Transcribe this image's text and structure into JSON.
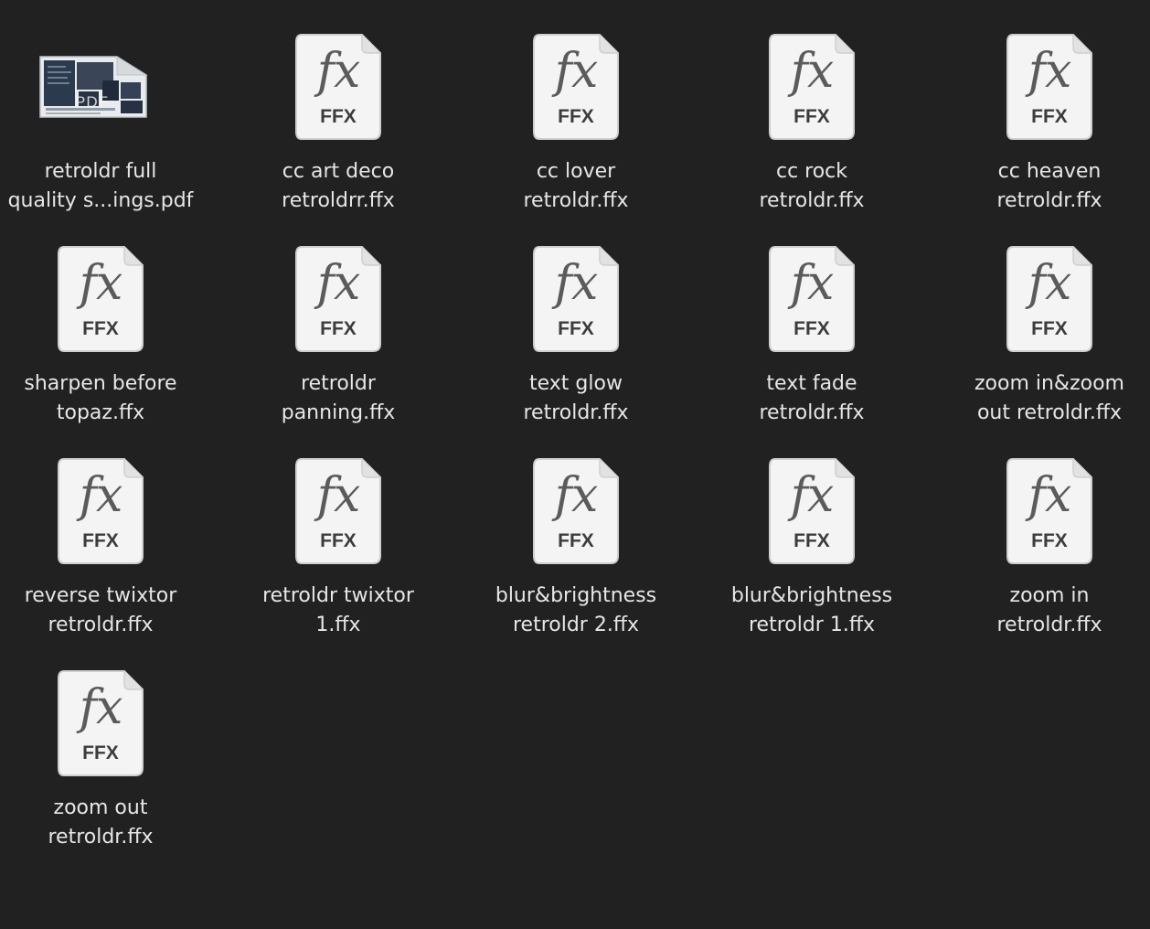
{
  "files": [
    {
      "name_line1": "retroldr full",
      "name_line2": "quality s...ings.pdf",
      "kind": "pdf",
      "thumb_label": "PDF"
    },
    {
      "name_line1": "cc art deco",
      "name_line2": "retroldrr.ffx",
      "kind": "ffx",
      "glyph": "fx",
      "ext": "FFX"
    },
    {
      "name_line1": "cc lover",
      "name_line2": "retroldr.ffx",
      "kind": "ffx",
      "glyph": "fx",
      "ext": "FFX"
    },
    {
      "name_line1": "cc rock",
      "name_line2": "retroldr.ffx",
      "kind": "ffx",
      "glyph": "fx",
      "ext": "FFX"
    },
    {
      "name_line1": "cc heaven",
      "name_line2": "retroldr.ffx",
      "kind": "ffx",
      "glyph": "fx",
      "ext": "FFX"
    },
    {
      "name_line1": "sharpen before",
      "name_line2": "topaz.ffx",
      "kind": "ffx",
      "glyph": "fx",
      "ext": "FFX"
    },
    {
      "name_line1": "retroldr",
      "name_line2": "panning.ffx",
      "kind": "ffx",
      "glyph": "fx",
      "ext": "FFX"
    },
    {
      "name_line1": "text glow",
      "name_line2": "retroldr.ffx",
      "kind": "ffx",
      "glyph": "fx",
      "ext": "FFX"
    },
    {
      "name_line1": "text fade",
      "name_line2": "retroldr.ffx",
      "kind": "ffx",
      "glyph": "fx",
      "ext": "FFX"
    },
    {
      "name_line1": "zoom in&zoom",
      "name_line2": "out retroldr.ffx",
      "kind": "ffx",
      "glyph": "fx",
      "ext": "FFX"
    },
    {
      "name_line1": "reverse twixtor",
      "name_line2": "retroldr.ffx",
      "kind": "ffx",
      "glyph": "fx",
      "ext": "FFX"
    },
    {
      "name_line1": "retroldr twixtor",
      "name_line2": "1.ffx",
      "kind": "ffx",
      "glyph": "fx",
      "ext": "FFX"
    },
    {
      "name_line1": "blur&brightness",
      "name_line2": "retroldr 2.ffx",
      "kind": "ffx",
      "glyph": "fx",
      "ext": "FFX"
    },
    {
      "name_line1": "blur&brightness",
      "name_line2": "retroldr 1.ffx",
      "kind": "ffx",
      "glyph": "fx",
      "ext": "FFX"
    },
    {
      "name_line1": "zoom in",
      "name_line2": "retroldr.ffx",
      "kind": "ffx",
      "glyph": "fx",
      "ext": "FFX"
    },
    {
      "name_line1": "zoom out",
      "name_line2": "retroldr.ffx",
      "kind": "ffx",
      "glyph": "fx",
      "ext": "FFX"
    }
  ],
  "colors": {
    "background": "#212121",
    "doc_fill": "#f4f4f4",
    "doc_border": "#cfcfcf",
    "label_text": "#e6e6e6"
  }
}
